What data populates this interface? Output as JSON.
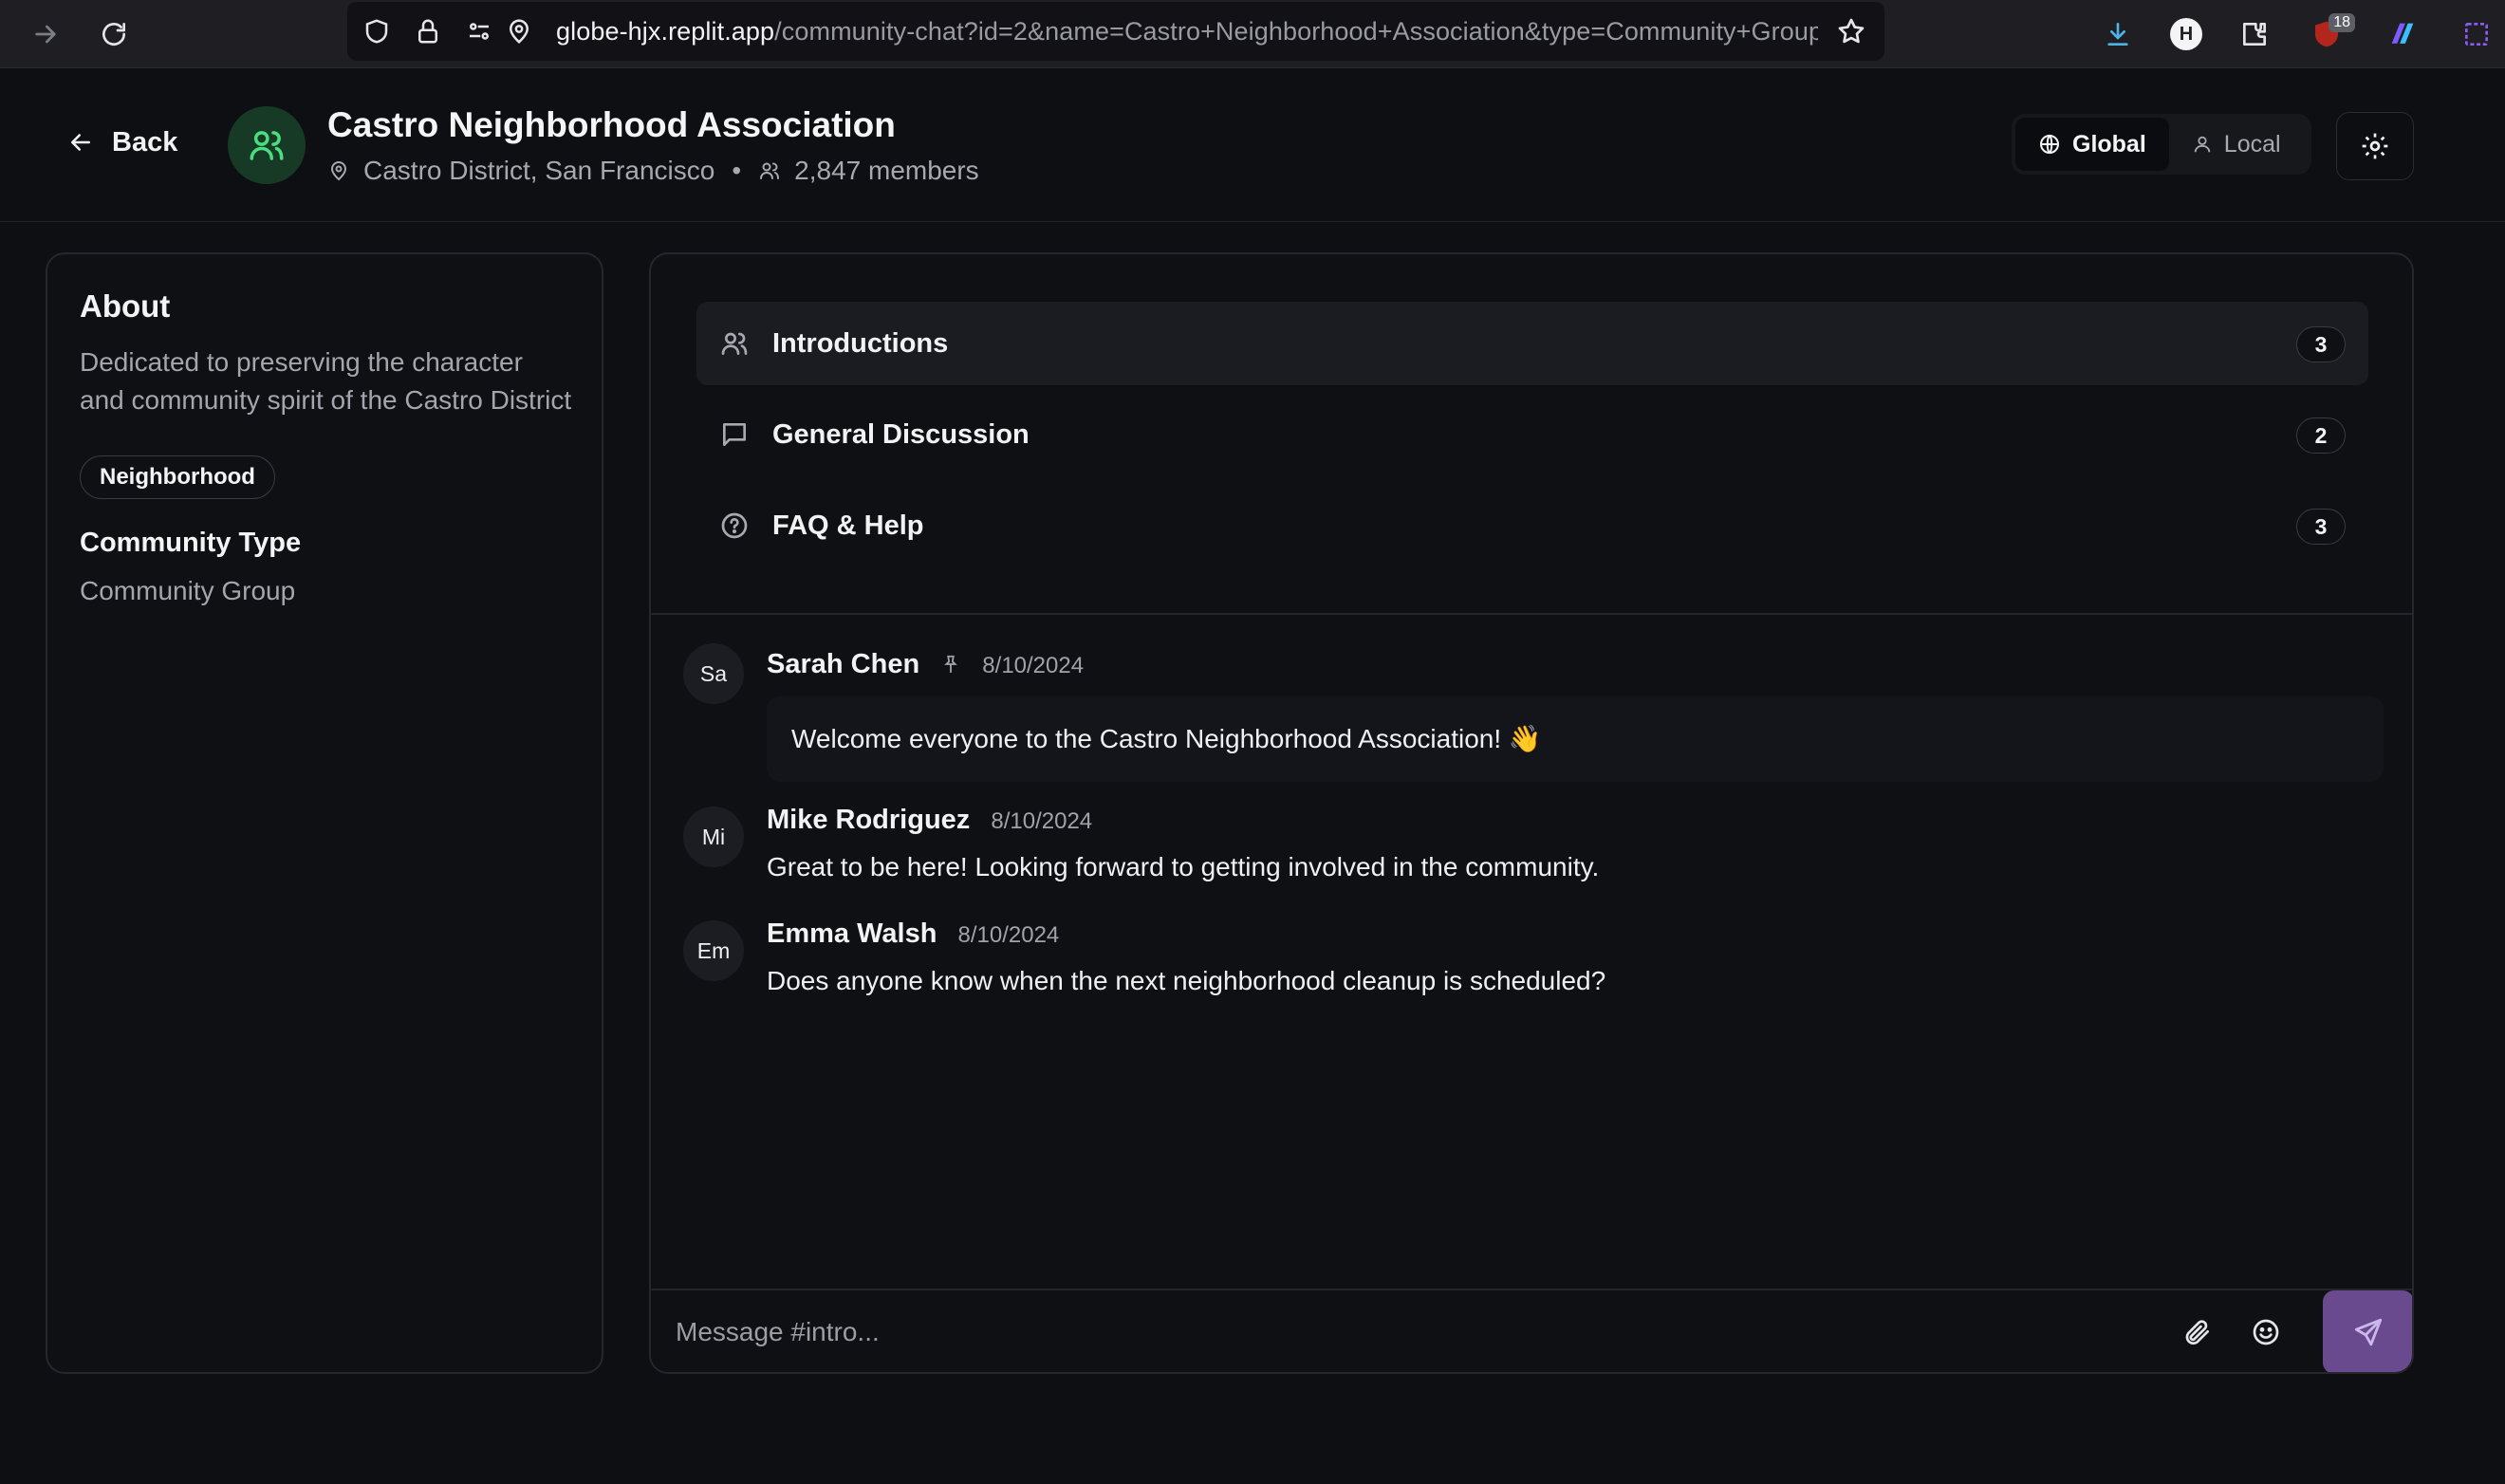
{
  "browser": {
    "url_host": "globe-hjx.replit.app",
    "url_path": "/community-chat?id=2&name=Castro+Neighborhood+Association&type=Community+Group",
    "extension_badge": "18",
    "ext_h_label": "H"
  },
  "header": {
    "back_label": "Back",
    "title": "Castro Neighborhood Association",
    "location": "Castro District, San Francisco",
    "separator": "•",
    "members": "2,847 members",
    "toggle": {
      "global_label": "Global",
      "local_label": "Local"
    }
  },
  "sidebar": {
    "about_title": "About",
    "about_desc": "Dedicated to preserving the character and community spirit of the Castro District",
    "tag": "Neighborhood",
    "community_type_title": "Community Type",
    "community_type_value": "Community Group"
  },
  "channels": [
    {
      "label": "Introductions",
      "count": "3",
      "icon": "users-icon"
    },
    {
      "label": "General Discussion",
      "count": "2",
      "icon": "chat-bubble-icon"
    },
    {
      "label": "FAQ & Help",
      "count": "3",
      "icon": "help-circle-icon"
    }
  ],
  "messages": [
    {
      "initials": "Sa",
      "author": "Sarah Chen",
      "date": "8/10/2024",
      "text": "Welcome everyone to the Castro Neighborhood Association! 👋",
      "pinned": true
    },
    {
      "initials": "Mi",
      "author": "Mike Rodriguez",
      "date": "8/10/2024",
      "text": "Great to be here! Looking forward to getting involved in the community.",
      "pinned": false
    },
    {
      "initials": "Em",
      "author": "Emma Walsh",
      "date": "8/10/2024",
      "text": "Does anyone know when the next neighborhood cleanup is scheduled?",
      "pinned": false
    }
  ],
  "composer": {
    "placeholder": "Message #intro..."
  },
  "colors": {
    "accent_green": "#4ade80",
    "send_purple": "#6a4a8e",
    "background": "#0e0f12"
  }
}
